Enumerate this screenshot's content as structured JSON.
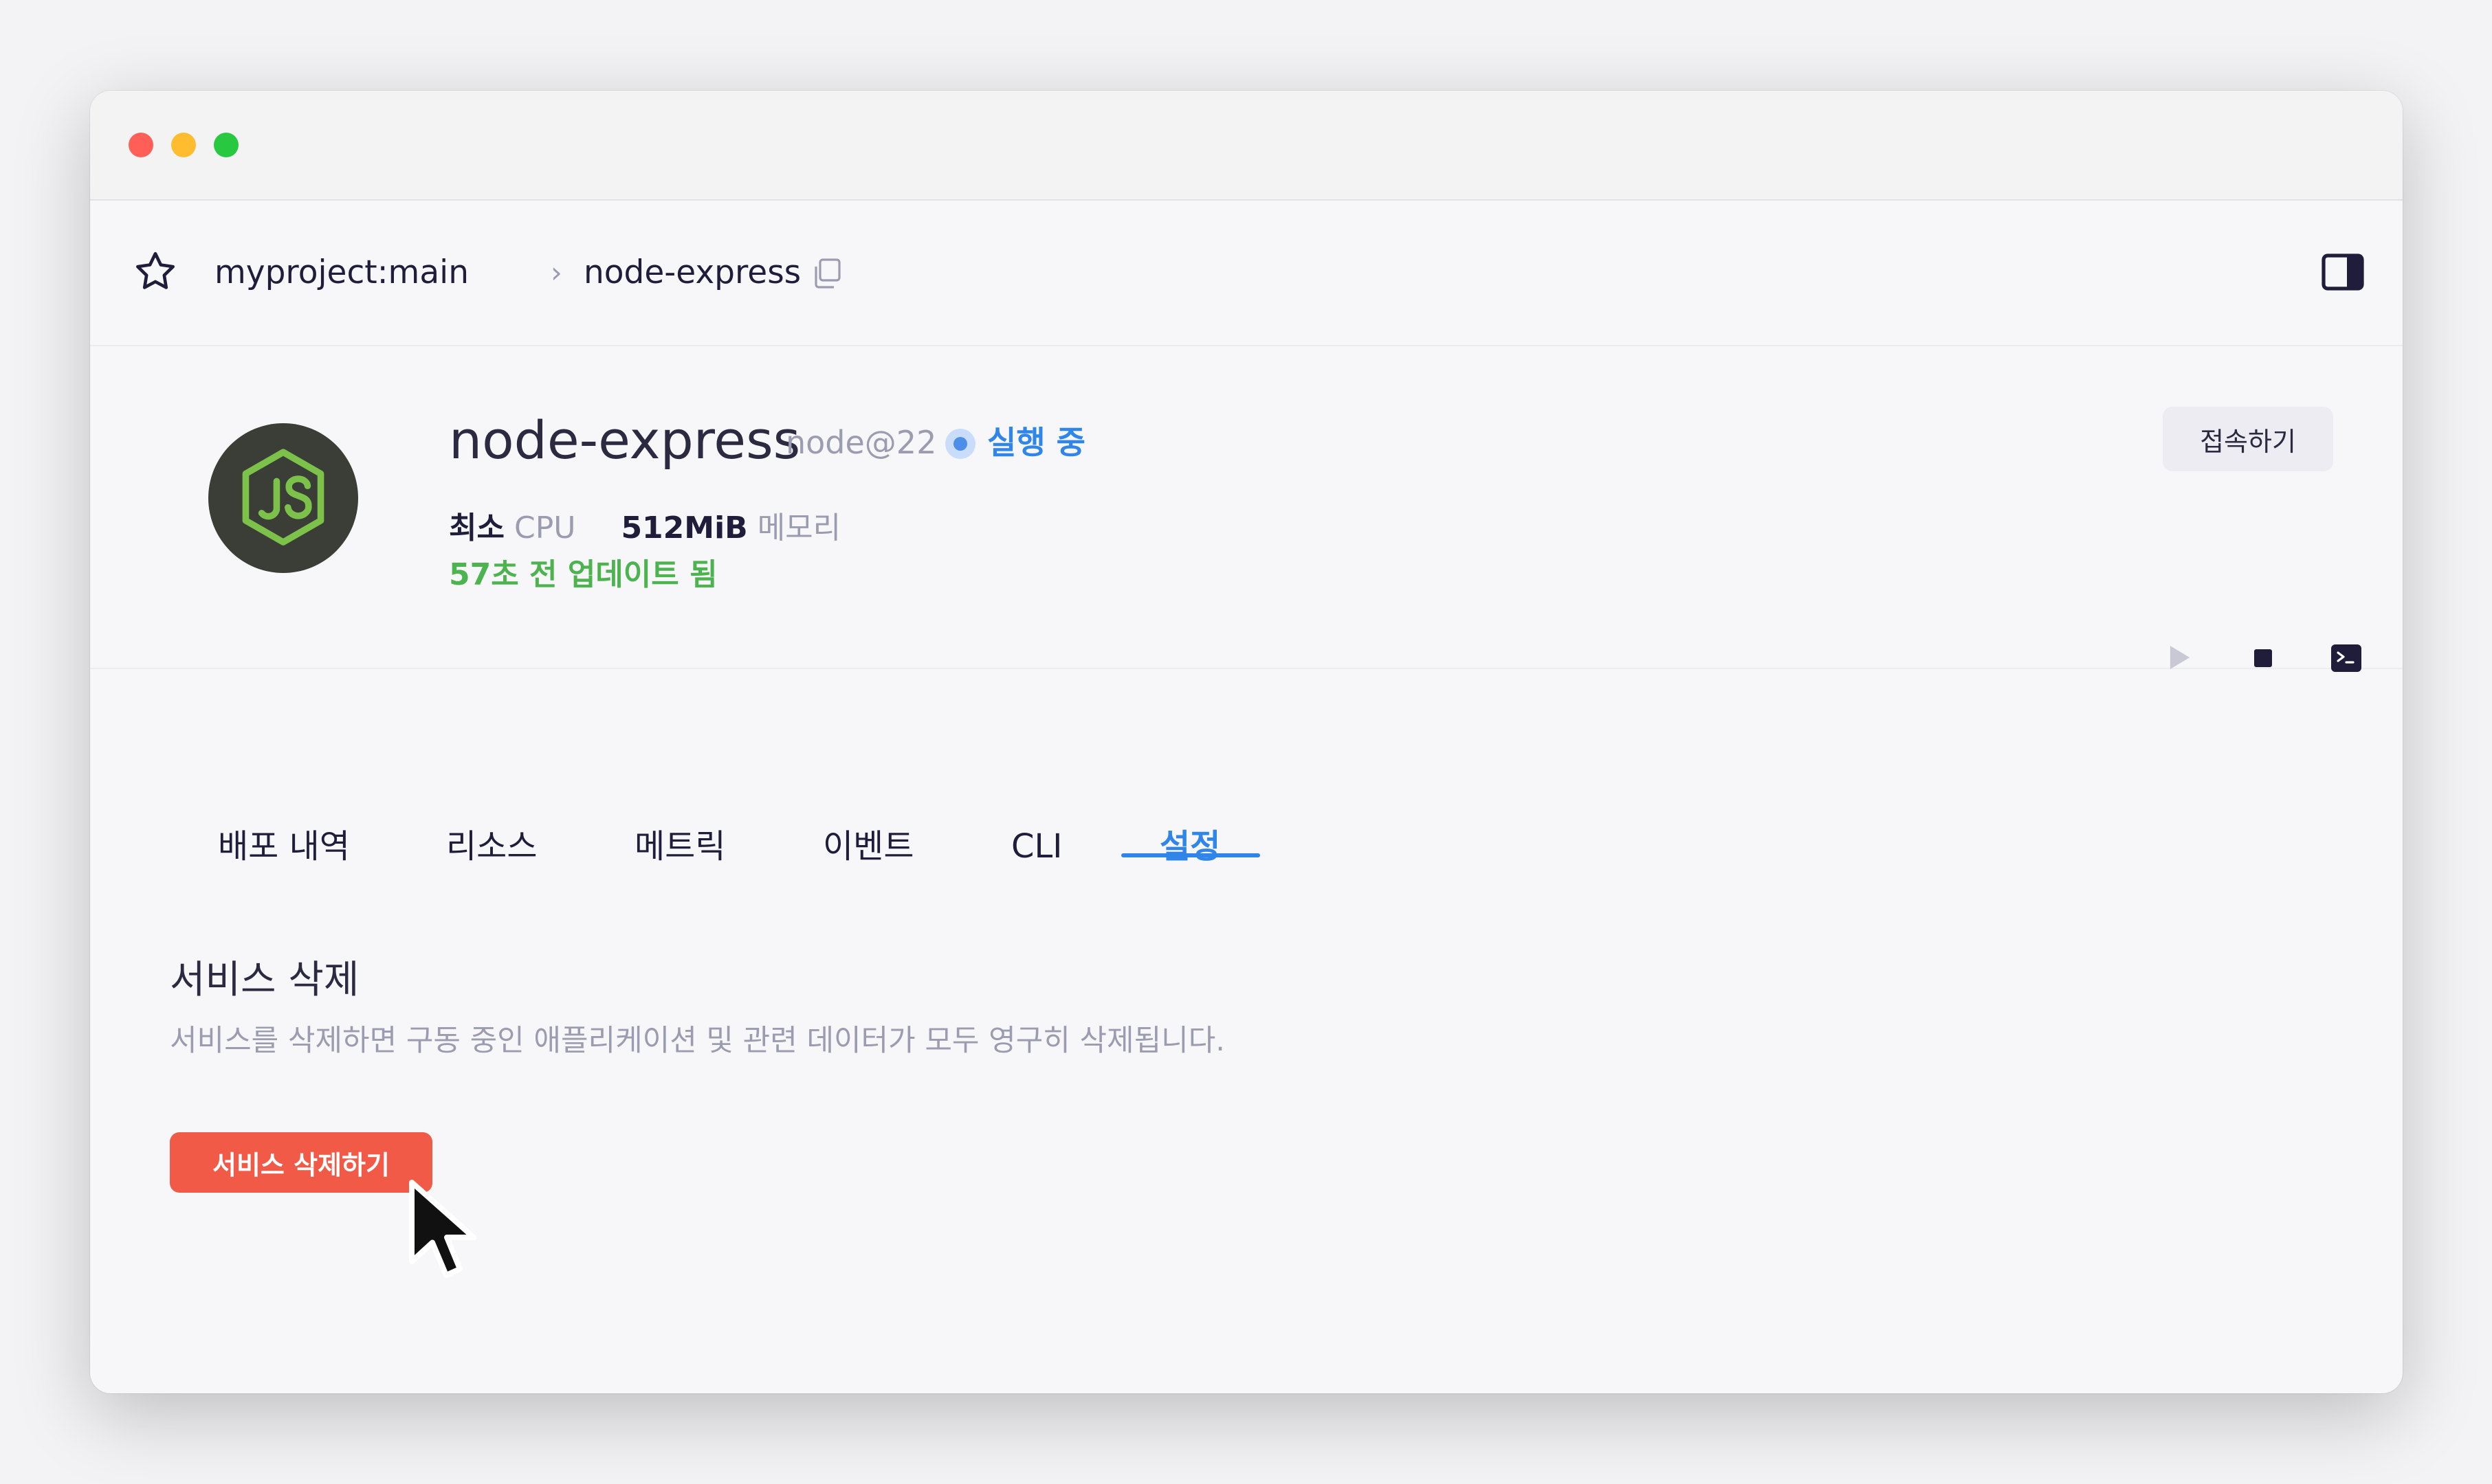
{
  "window": {
    "traffic_lights": [
      "close",
      "minimize",
      "zoom"
    ]
  },
  "breadcrumb": {
    "project": "myproject:main",
    "separator": "›",
    "service": "node-express"
  },
  "service": {
    "name": "node-express",
    "runtime": "node@22",
    "status": "실행 중",
    "cpu_prefix": "최소",
    "cpu_label": "CPU",
    "memory_value": "512MiB",
    "memory_label": "메모리",
    "updated": "57초 전 업데이트 됨",
    "connect_label": "접속하기"
  },
  "tabs": [
    {
      "label": "배포 내역",
      "active": false
    },
    {
      "label": "리소스",
      "active": false
    },
    {
      "label": "메트릭",
      "active": false
    },
    {
      "label": "이벤트",
      "active": false
    },
    {
      "label": "CLI",
      "active": false
    },
    {
      "label": "설정",
      "active": true
    }
  ],
  "danger": {
    "title": "서비스 삭제",
    "description": "서비스를 삭제하면 구동 중인 애플리케이션 및 관련 데이터가 모두 영구히 삭제됩니다.",
    "button": "서비스 삭제하기"
  },
  "colors": {
    "accent": "#2f86e8",
    "danger": "#f25a48",
    "success": "#4db34f",
    "node_logo": "#7cc24a"
  },
  "icons": [
    "star-icon",
    "copy-icon",
    "sidebar-toggle-icon",
    "nodejs-logo-icon",
    "play-icon",
    "stop-icon",
    "terminal-icon",
    "cursor-icon"
  ]
}
